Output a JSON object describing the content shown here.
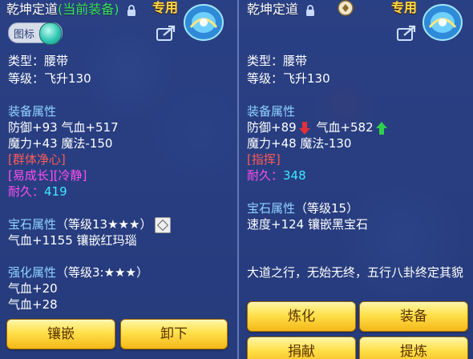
{
  "left": {
    "item_name": "乾坤定道",
    "current_equip_tag": "(当前装备)",
    "special_tag": "专用",
    "toggle_label": "图标",
    "type_line": "类型：腰带",
    "level_line": "等级：飞升130",
    "equip_attr_title": "装备属性",
    "attr_line1_a": "防御+93",
    "attr_line1_b": "气血+517",
    "attr_line2": "魔力+43 魔法-150",
    "special_effect": "[群体净心]",
    "special_effect2": "[易成长][冷静]",
    "durability_label": "耐久：",
    "durability_value": "419",
    "gem_title": "宝石属性",
    "gem_level": "（等级13★★★）",
    "gem_line": "气血+1155 镶嵌红玛瑙",
    "enhance_title": "强化属性",
    "enhance_level": "（等级3:★★★）",
    "enhance_line1": "气血+20",
    "enhance_line2": "气血+28",
    "btn_inlay": "镶嵌",
    "btn_unequip": "卸下"
  },
  "right": {
    "item_name": "乾坤定道",
    "special_tag": "专用",
    "type_line": "类型：腰带",
    "level_line": "等级：飞升130",
    "equip_attr_title": "装备属性",
    "attr_line1_a": "防御+89",
    "attr_line1_b": "气血+582",
    "attr_line2": "魔力+48 魔法-130",
    "special_effect": "[指挥]",
    "durability_label": "耐久：",
    "durability_value": "348",
    "gem_title": "宝石属性",
    "gem_level": "（等级15）",
    "gem_line": "速度+124 镶嵌黑宝石",
    "description": "大道之行，无始无终，五行八卦终定其貌",
    "btn_refine": "炼化",
    "btn_equip": "装备",
    "btn_donate": "捐献",
    "btn_temper": "提炼"
  },
  "colors": {
    "panel_bg": "#283e82",
    "section_title": "#8fd3ff",
    "special_effect": "#ff5a5a",
    "magic_effect": "#ff4df0",
    "durability": "#3ee8ff",
    "current_tag": "#38e05a",
    "special_tag": "#ffd84a",
    "button": "#ffe04a"
  }
}
